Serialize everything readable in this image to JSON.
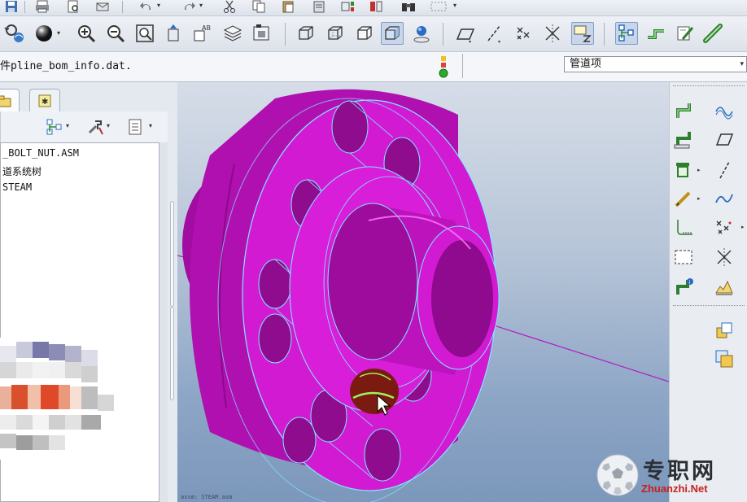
{
  "message_bar": {
    "text": "件pline_bom_info.dat.",
    "filter_value": "管道项"
  },
  "model_tree": {
    "items": [
      "_BOLT_NUT.ASM",
      "道系统树",
      "STEAM"
    ]
  },
  "viewport": {
    "status_line": "assm: STEAM.asm"
  },
  "watermark": {
    "cn": "专职网",
    "en": "Zhuanzhi.Net"
  },
  "colors": {
    "model_fill": "#cc10cc",
    "model_edge": "#7fe9ff",
    "viewport_top": "#d6dde8",
    "viewport_bottom": "#7b97bb",
    "axis_line": "#b020c0",
    "highlight": "#7a1a10",
    "highlight_edge": "#9ff060",
    "watermark_red": "#c62020"
  },
  "icons": {
    "top_row": [
      "save-icon",
      "print-icon",
      "print-preview-icon",
      "send-icon",
      "undo-icon",
      "redo-icon",
      "cut-icon",
      "copy-icon",
      "paste-icon",
      "paste-special-icon",
      "regenerate-icon",
      "family-table-icon",
      "binoculars-icon",
      "select-box-icon"
    ],
    "main_row": [
      "repaint-icon",
      "shade-sphere-icon",
      "zoom-in-icon",
      "zoom-out-icon",
      "refit-icon",
      "reorient-icon",
      "saved-views-icon",
      "layers-icon",
      "view-manager-icon",
      "wireframe-icon",
      "hidden-line-icon",
      "no-hidden-icon",
      "shading-icon",
      "spin-center-icon",
      "datum-plane-icon",
      "datum-axis-icon",
      "datum-point-icon",
      "coordinate-system-icon",
      "annotation-display-icon",
      "piping-tree-icon",
      "route-pipe-icon",
      "edit-pipe-icon",
      "pipe-line-icon"
    ],
    "left_tabs": [
      "model-tree-tab-icon",
      "folder-browser-tab-icon"
    ],
    "left_toolbar": [
      "tree-show-icon",
      "tree-settings-icon",
      "tree-columns-icon"
    ],
    "right_column_a": [
      "pipe-segment-icon",
      "pipe-branch-icon",
      "insert-fitting-icon",
      "sketch-pipe-icon",
      "pipe-corner-icon",
      "pipe-frame-icon",
      "pipe-info-icon"
    ],
    "right_column_b": [
      "curve-icon",
      "datum-plane-icon",
      "datum-axis-icon",
      "sketched-curve-icon",
      "datum-points-icon",
      "coordinate-system-icon",
      "analysis-icon",
      "copy-geometry-icon",
      "shrinkwrap-icon"
    ]
  }
}
